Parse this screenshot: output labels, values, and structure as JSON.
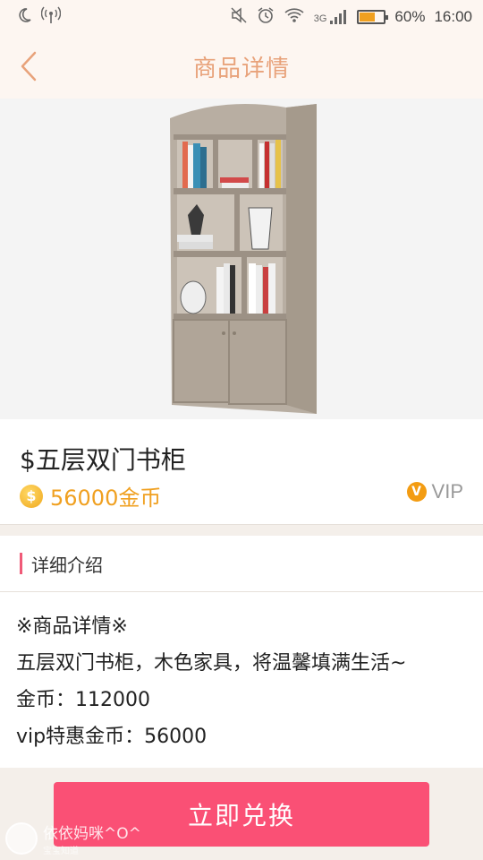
{
  "status_bar": {
    "battery_percent": "60%",
    "battery_level": 0.6,
    "network": "3G",
    "time": "16:00"
  },
  "header": {
    "title": "商品详情"
  },
  "product": {
    "name": "$五层双门书柜",
    "price": "56000金币",
    "coin_symbol": "$",
    "vip_badge_icon": "V",
    "vip_label": "VIP"
  },
  "details": {
    "section_title": "详细介绍",
    "lines": [
      "※商品详情※",
      "五层双门书柜，木色家具，将温馨填满生活~",
      "金币：112000",
      "vip特惠金币：56000"
    ]
  },
  "action": {
    "exchange_label": "立即兑换"
  },
  "watermark": {
    "name": "依依妈咪^O^",
    "sub": "宝宝知道"
  },
  "colors": {
    "accent_pink": "#fa5075",
    "title_orange": "#e8a27a",
    "price_orange": "#f0a020",
    "section_bar": "#f05a78"
  }
}
